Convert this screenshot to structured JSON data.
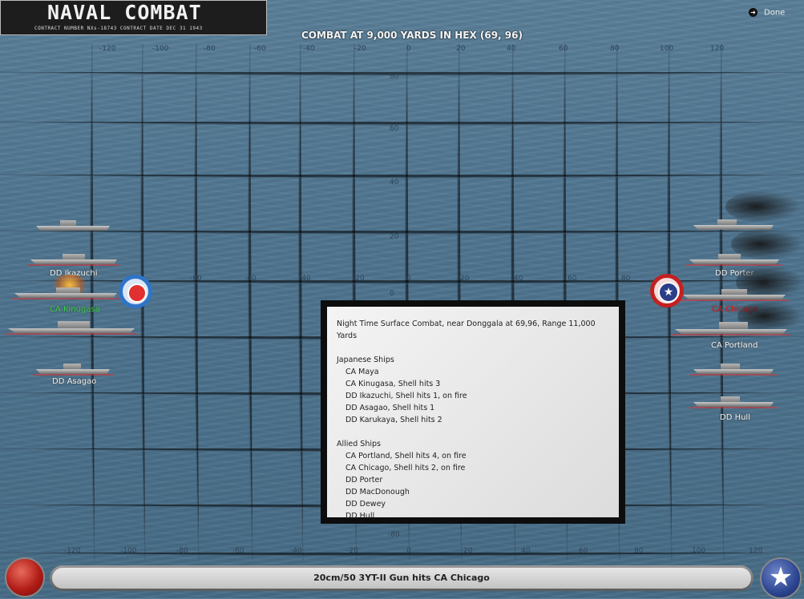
{
  "logo": {
    "title": "NAVAL COMBAT",
    "subtitle": "CONTRACT NUMBER  NXs-18743        CONTRACT DATE  DEC 31  1943"
  },
  "header": {
    "combat_title": "COMBAT AT 9,000 YARDS IN HEX (69, 96)",
    "done_label": "Done"
  },
  "grid": {
    "top_ticks": [
      "-120",
      "-100",
      "-80",
      "-60",
      "-40",
      "-20",
      "0",
      "20",
      "40",
      "60",
      "80",
      "100",
      "120"
    ],
    "mid_ticks": [
      "-80",
      "-60",
      "-40",
      "-20",
      "0",
      "20",
      "40",
      "60",
      "80"
    ],
    "bottom_ticks": [
      "-120",
      "-100",
      "-80",
      "-60",
      "-40",
      "-20",
      "0",
      "20",
      "40",
      "60",
      "80",
      "100",
      "120"
    ],
    "y_ticks_upper": [
      "80",
      "60",
      "40",
      "20",
      "0"
    ],
    "y_ticks_lower": [
      "-80"
    ]
  },
  "japanese_labels": {
    "ikazuchi": "DD Ikazuchi",
    "kinugasa": "CA Kinugasa",
    "asagao": "DD Asagao"
  },
  "allied_labels": {
    "porter": "DD Porter",
    "chicago": "CA Chicago",
    "portland": "CA Portland",
    "hull": "DD Hull"
  },
  "colors": {
    "highlight_green": "#35d24a",
    "highlight_red": "#e02020"
  },
  "report": {
    "heading": "Night Time Surface Combat, near Donggala at 69,96, Range 11,000 Yards",
    "japanese_title": "Japanese Ships",
    "japanese_ships": [
      "CA Maya",
      "CA Kinugasa, Shell hits 3",
      "DD Ikazuchi, Shell hits 1,  on fire",
      "DD Asagao, Shell hits 1",
      "DD Karukaya, Shell hits 2"
    ],
    "allied_title": "Allied Ships",
    "allied_ships": [
      "CA Portland, Shell hits 4,  on fire",
      "CA Chicago, Shell hits 2,  on fire",
      "DD Porter",
      "DD MacDonough",
      "DD Dewey",
      "DD Hull"
    ]
  },
  "status_bar": {
    "message": "20cm/50 3YT-II Gun hits CA Chicago"
  }
}
